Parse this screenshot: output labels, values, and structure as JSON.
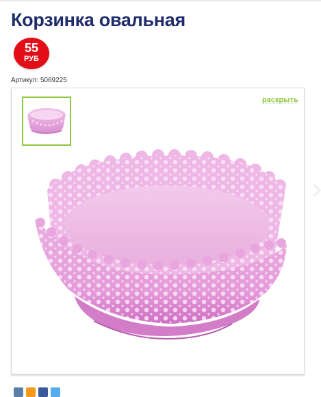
{
  "product": {
    "title": "Корзинка овальная",
    "price": {
      "value": "55",
      "currency": "РУБ"
    },
    "sku": {
      "label": "Артикул:",
      "value": "5069225"
    }
  },
  "gallery": {
    "expand_label": "раскрыть",
    "thumbnail_icon": "basket-thumbnail",
    "main_image": "pink-lace-oval-basket"
  },
  "share": {
    "icons": [
      "vkontakte-icon",
      "odnoklassniki-icon",
      "facebook-icon",
      "twitter-icon"
    ]
  },
  "colors": {
    "title": "#1f2d6d",
    "price_badge": "#e30d17",
    "accent_green": "#8dc63f",
    "basket_pink": "#e7a2d9"
  }
}
